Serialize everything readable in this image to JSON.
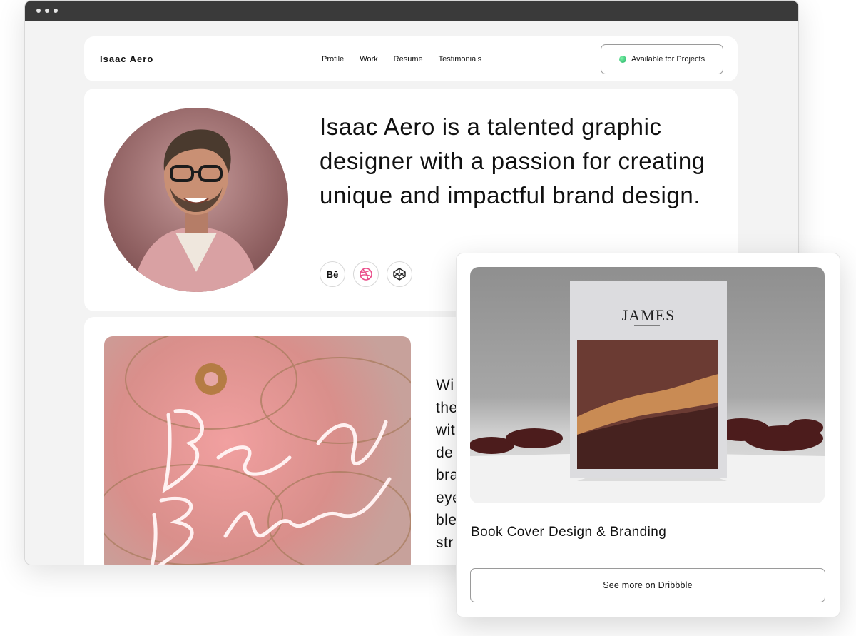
{
  "nav": {
    "brand": "Isaac Aero",
    "items": [
      {
        "label": "Profile"
      },
      {
        "label": "Work"
      },
      {
        "label": "Resume"
      },
      {
        "label": "Testimonials"
      }
    ],
    "availability": "Available for Projects"
  },
  "hero": {
    "headline": "Isaac Aero is a talented graphic designer with a passion for creating unique and impactful brand design.",
    "socials": [
      {
        "icon": "behance-icon",
        "label": "Bē"
      },
      {
        "icon": "dribbble-icon"
      },
      {
        "icon": "codepen-icon"
      }
    ]
  },
  "work": {
    "side_text_lines": [
      "Wi",
      "the",
      "wit",
      "de",
      "bra",
      "eye",
      "ble",
      "str"
    ]
  },
  "featured": {
    "cover_title": "JAMES",
    "title": "Book Cover Design & Branding",
    "cta": "See more on Dribbble"
  },
  "colors": {
    "accent_green": "#1fb063",
    "dribbble_pink": "#ea4c89"
  }
}
